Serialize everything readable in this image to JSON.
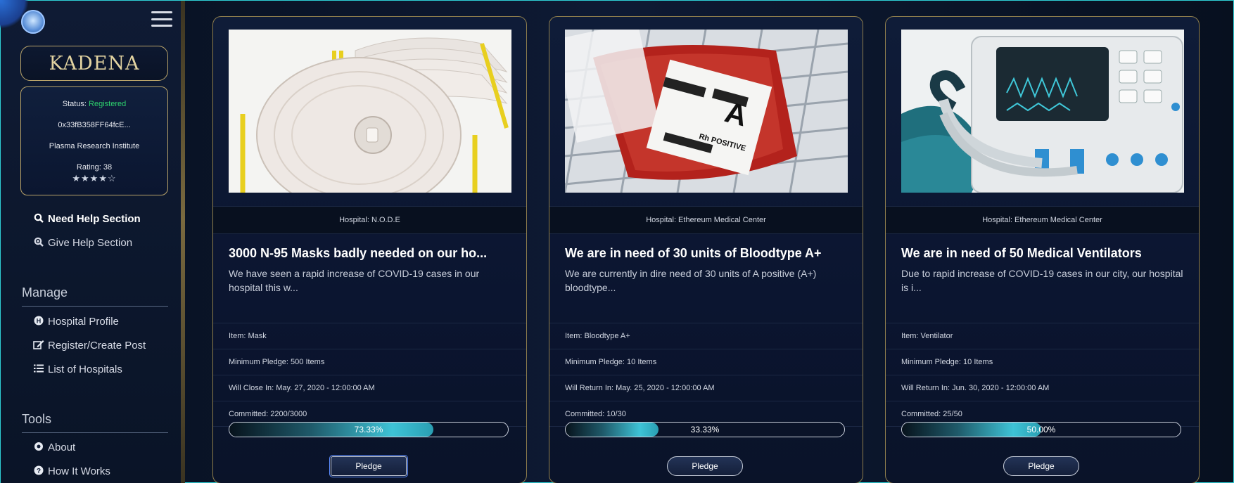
{
  "sidebar": {
    "brand": "KADENA",
    "status_label": "Status: ",
    "status_value": "Registered",
    "address": "0x33fB358FF64fcE...",
    "org": "Plasma Research Institute",
    "rating": "Rating: 38",
    "stars": "★★★★☆",
    "stars_value": 4,
    "nav": {
      "need_help": "Need Help Section",
      "give_help": "Give Help Section"
    },
    "manage_title": "Manage",
    "manage": {
      "hospital_profile": "Hospital Profile",
      "register_post": "Register/Create Post",
      "list_hospitals": "List of Hospitals"
    },
    "tools_title": "Tools",
    "tools": {
      "about": "About",
      "how_it_works": "How It Works"
    }
  },
  "cards": [
    {
      "hospital": "Hospital: N.O.D.E",
      "title": "3000 N-95 Masks badly needed on our ho...",
      "description": "We have seen a rapid increase of COVID-19 cases in our hospital this w...",
      "item": "Item: Mask",
      "min_pledge": "Minimum Pledge: 500 Items",
      "deadline": "Will Close In: May. 27, 2020 - 12:00:00 AM",
      "committed": "Committed: 2200/3000",
      "progress_label": "73.33%",
      "progress": 0.7333,
      "button": "Pledge"
    },
    {
      "hospital": "Hospital: Ethereum Medical Center",
      "title": "We are in need of 30 units of Bloodtype A+",
      "description": "We are currently in dire need of 30 units of A positive (A+) bloodtype...",
      "item": "Item: Bloodtype A+",
      "min_pledge": "Minimum Pledge: 10 Items",
      "deadline": "Will Return In: May. 25, 2020 - 12:00:00 AM",
      "committed": "Committed: 10/30",
      "progress_label": "33.33%",
      "progress": 0.3333,
      "button": "Pledge",
      "img_text": "A",
      "img_text2": "Rh POSITIVE"
    },
    {
      "hospital": "Hospital: Ethereum Medical Center",
      "title": "We are in need of 50 Medical Ventilators",
      "description": "Due to rapid increase of COVID-19 cases in our city, our hospital is i...",
      "item": "Item: Ventilator",
      "min_pledge": "Minimum Pledge: 10 Items",
      "deadline": "Will Return In: Jun. 30, 2020 - 12:00:00 AM",
      "committed": "Committed: 25/50",
      "progress_label": "50.00%",
      "progress": 0.5,
      "button": "Pledge"
    }
  ]
}
